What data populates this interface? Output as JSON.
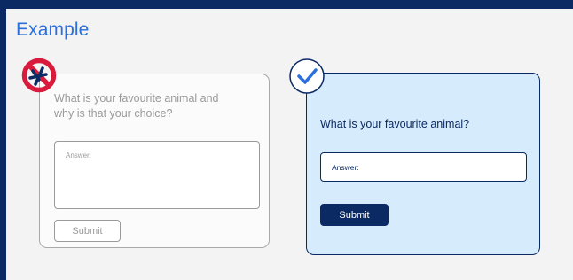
{
  "page": {
    "title": "Example"
  },
  "bad_example": {
    "question": "What is your favourite animal and why is that your choice?",
    "answer_placeholder": "Answer:",
    "submit_label": "Submit",
    "badge_icon": "prohibited-icon",
    "badge_color": "#d81b3c"
  },
  "good_example": {
    "question": "What is your favourite animal?",
    "answer_placeholder": "Answer:",
    "submit_label": "Submit",
    "badge_icon": "checkmark-icon",
    "accent_color": "#0b2a63",
    "card_color": "#d6ebfb"
  }
}
